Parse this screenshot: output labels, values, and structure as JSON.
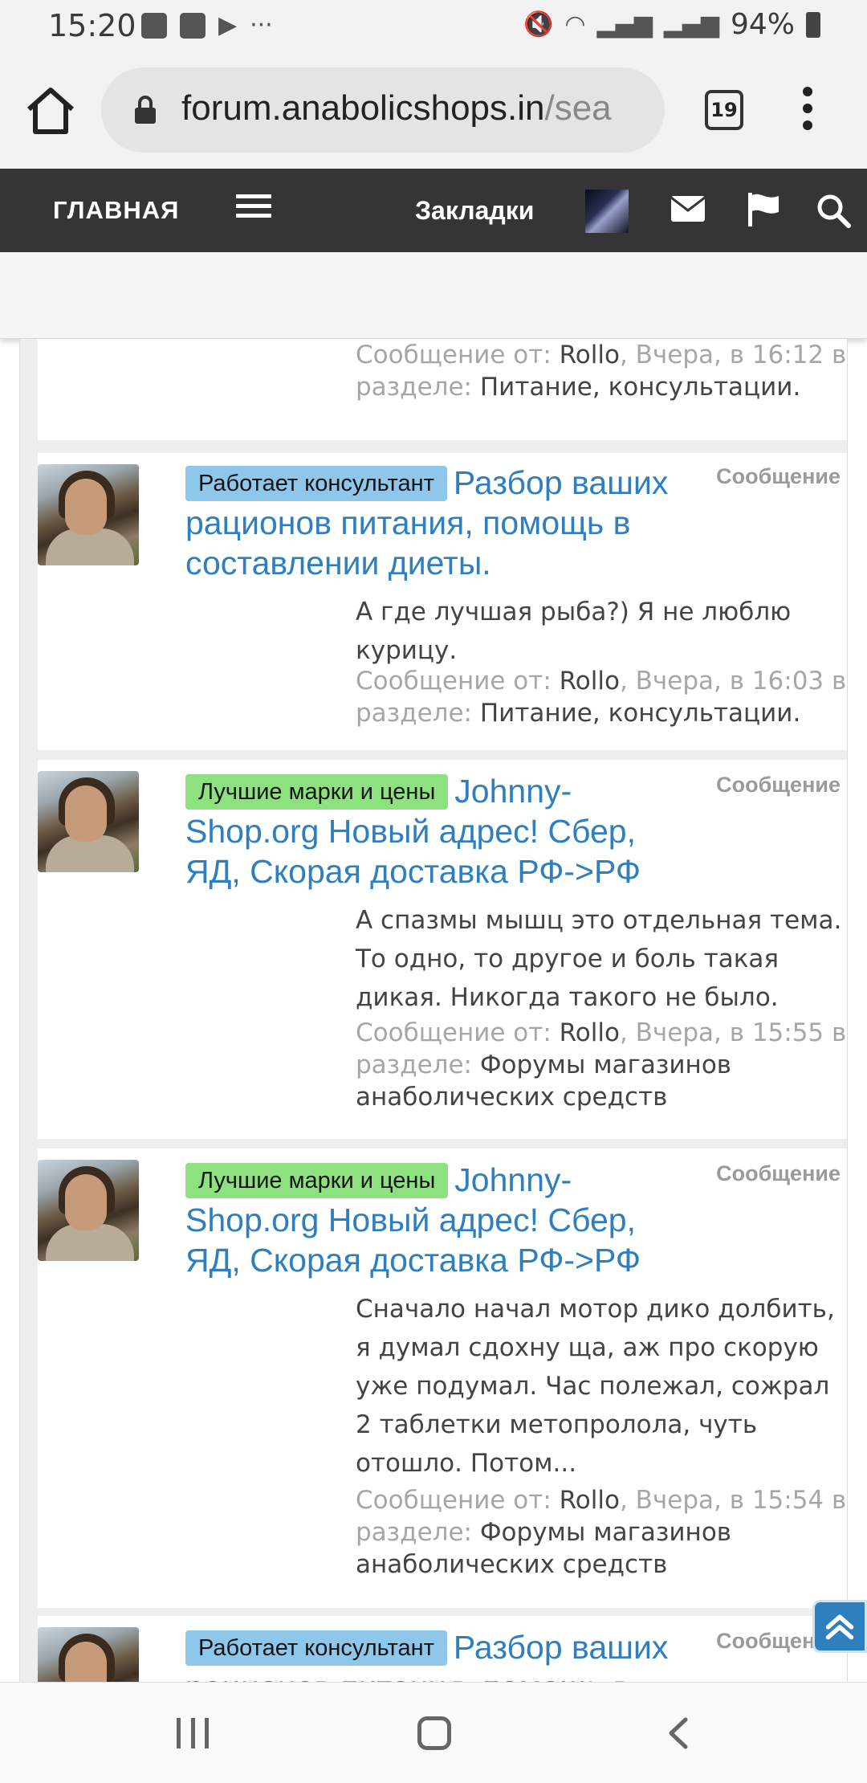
{
  "status": {
    "time": "15:20",
    "ellipsis": "···",
    "battery": "94%",
    "icons": [
      "image-icon",
      "music-icon",
      "play-store-icon",
      "mute-icon",
      "wifi-icon",
      "signal-icon",
      "battery-icon"
    ]
  },
  "browser": {
    "url_main": "forum.anabolicshops.in",
    "url_rest": "/sea",
    "tab_count": "19"
  },
  "forum_nav": {
    "home": "ГЛАВНАЯ",
    "bookmarks": "Закладки"
  },
  "results": [
    {
      "meta_prefix": "Сообщение от:",
      "author": "Rollo",
      "date": ", Вчера, в 16:12 в",
      "section_prefix": "разделе:",
      "section": "Питание, консультации."
    },
    {
      "prefix": "Работает консультант",
      "prefix_color": "#8fc7ea",
      "title": "Разбор ваших рационов питания, помощь в составлении диеты.",
      "type": "Сообщение",
      "snippet": "А где лучшая рыба?) Я не люблю курицу.",
      "meta_prefix": "Сообщение от:",
      "author": "Rollo",
      "date": ", Вчера, в 16:03 в",
      "section_prefix": "разделе:",
      "section": "Питание, консультации."
    },
    {
      "prefix": "Лучшие марки и цены",
      "prefix_color": "#8de27f",
      "title": "Johnny-Shop.org Новый адрес! Сбер, ЯД, Скорая доставка РФ->РФ",
      "type": "Сообщение",
      "snippet": "А спазмы мышц это отдельная тема. То одно, то другое и боль такая дикая. Никогда такого не было.",
      "meta_prefix": "Сообщение от:",
      "author": "Rollo",
      "date": ", Вчера, в 15:55 в",
      "section_prefix": "разделе:",
      "section": "Форумы магазинов анаболических средств"
    },
    {
      "prefix": "Лучшие марки и цены",
      "prefix_color": "#8de27f",
      "title": "Johnny-Shop.org Новый адрес! Сбер, ЯД, Скорая доставка РФ->РФ",
      "type": "Сообщение",
      "snippet": "Сначало начал мотор дико долбить, я думал сдохну ща, аж про скорую уже подумал. Час полежал, сожрал 2 таблетки метопролола, чуть отошло. Потом...",
      "meta_prefix": "Сообщение от:",
      "author": "Rollo",
      "date": ", Вчера, в 15:54 в",
      "section_prefix": "разделе:",
      "section": "Форумы магазинов анаболических средств"
    },
    {
      "prefix": "Работает консультант",
      "prefix_color": "#8fc7ea",
      "title": "Разбор ваших рационов питания, помощь в",
      "type": "Сообщение"
    }
  ],
  "colors": {
    "link": "#2f7fbf",
    "nav_bg": "#353535",
    "prefix_blue": "#8fc7ea",
    "prefix_green": "#8de27f"
  }
}
